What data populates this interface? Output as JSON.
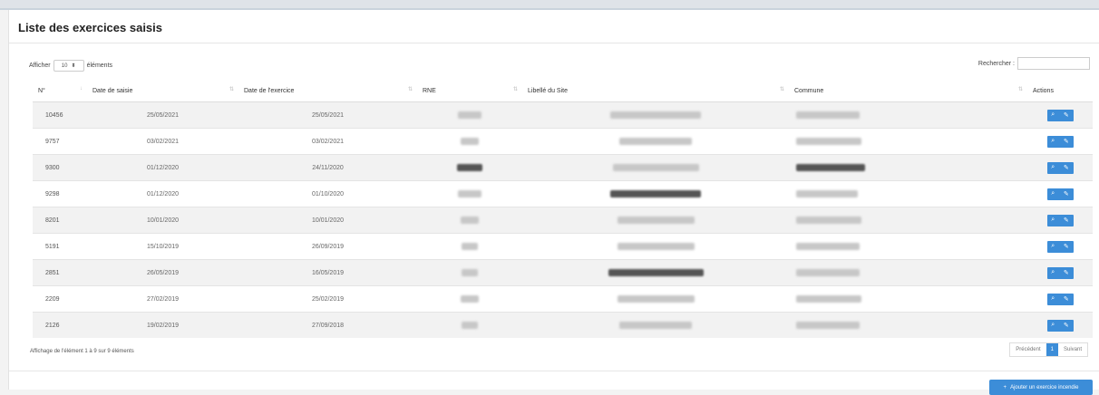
{
  "panel": {
    "title": "Liste des exercices saisis"
  },
  "length": {
    "label_before": "Afficher",
    "value": "10",
    "label_after": "éléments"
  },
  "search": {
    "label": "Rechercher :",
    "value": ""
  },
  "columns": [
    "N°",
    "Date de saisie",
    "Date de l'exercice",
    "RNE",
    "Libellé du Site",
    "Commune",
    "Actions"
  ],
  "rows": [
    {
      "num": "10456",
      "saisie": "25/05/2021",
      "exercice": "25/05/2021"
    },
    {
      "num": "9757",
      "saisie": "03/02/2021",
      "exercice": "03/02/2021"
    },
    {
      "num": "9300",
      "saisie": "01/12/2020",
      "exercice": "24/11/2020"
    },
    {
      "num": "9298",
      "saisie": "01/12/2020",
      "exercice": "01/10/2020"
    },
    {
      "num": "8201",
      "saisie": "10/01/2020",
      "exercice": "10/01/2020"
    },
    {
      "num": "5191",
      "saisie": "15/10/2019",
      "exercice": "26/09/2019"
    },
    {
      "num": "2851",
      "saisie": "26/05/2019",
      "exercice": "16/05/2019"
    },
    {
      "num": "2209",
      "saisie": "27/02/2019",
      "exercice": "25/02/2019"
    },
    {
      "num": "2126",
      "saisie": "19/02/2019",
      "exercice": "27/09/2018"
    }
  ],
  "info": "Affichage de l'élément 1 à 9 sur 9 éléments",
  "pager": {
    "prev": "Précédent",
    "current": "1",
    "next": "Suivant"
  },
  "add_button": {
    "label": "Ajouter un exercice incendie"
  },
  "colors": {
    "accent": "#3c8dd8",
    "row_alt": "#f2f2f2"
  },
  "icons": {
    "view": "search-icon",
    "edit": "edit-icon"
  }
}
